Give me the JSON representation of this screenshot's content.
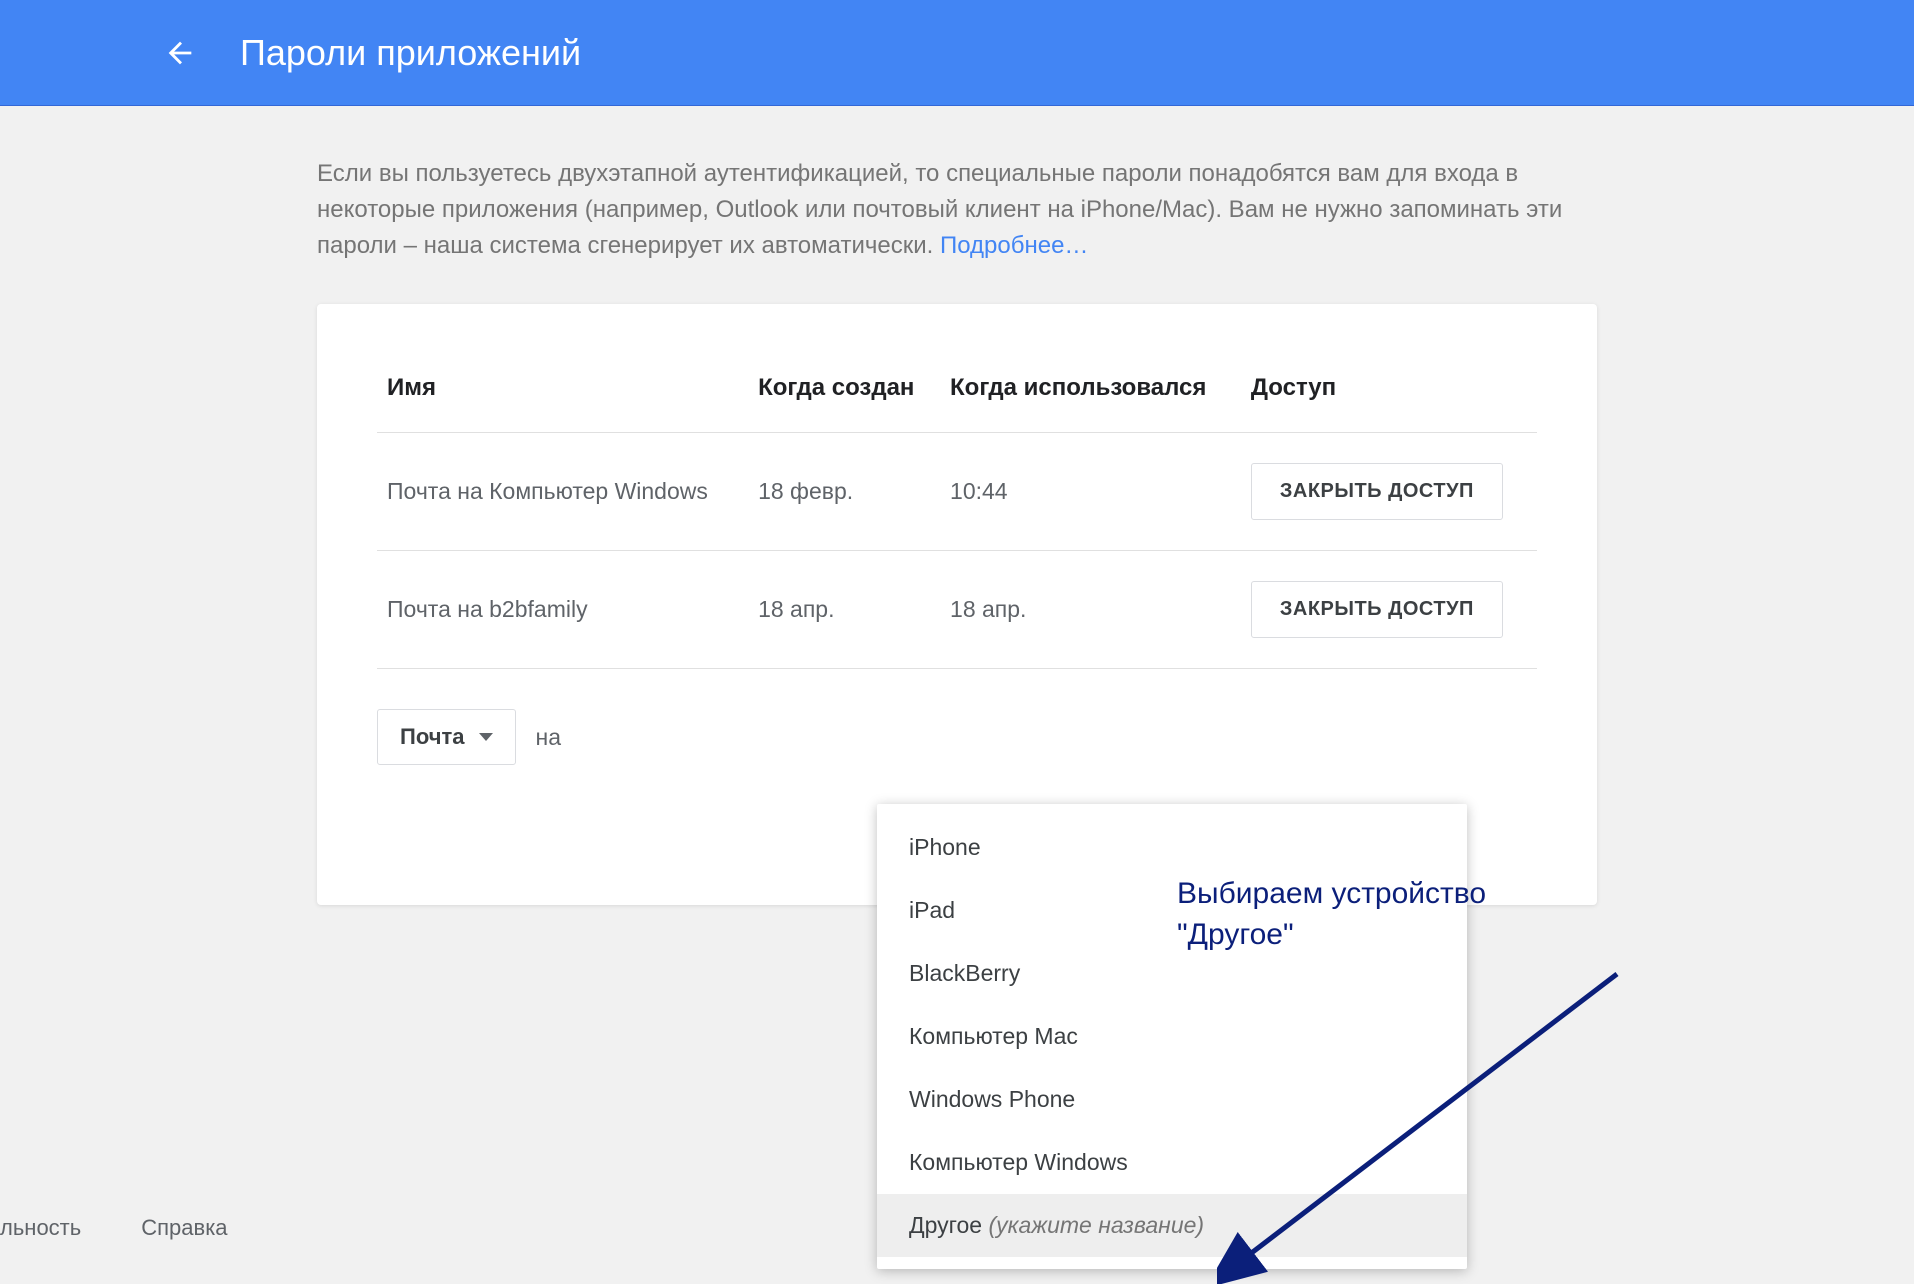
{
  "header": {
    "title": "Пароли приложений"
  },
  "intro": {
    "text_before_link": "Если вы пользуетесь двухэтапной аутентификацией, то специальные пароли понадобятся вам для входа в некоторые приложения (например, Outlook или почтовый клиент на iPhone/Mac). Вам не нужно запоминать эти пароли – наша система сгенерирует их автоматически. ",
    "link": "Подробнее…"
  },
  "table": {
    "headers": {
      "name": "Имя",
      "created": "Когда создан",
      "used": "Когда использовался",
      "access": "Доступ"
    },
    "revoke_label": "ЗАКРЫТЬ ДОСТУП",
    "rows": [
      {
        "name": "Почта на Компьютер Windows",
        "created": "18 февр.",
        "used": "10:44"
      },
      {
        "name": "Почта на b2bfamily",
        "created": "18 апр.",
        "used": "18 апр."
      }
    ]
  },
  "selector": {
    "app_label": "Почта",
    "on": "на"
  },
  "dropdown": {
    "items": [
      {
        "label": "iPhone"
      },
      {
        "label": "iPad"
      },
      {
        "label": "BlackBerry"
      },
      {
        "label": "Компьютер Mac"
      },
      {
        "label": "Windows Phone"
      },
      {
        "label": "Компьютер Windows"
      },
      {
        "label": "Другое ",
        "hint": "(укажите название)",
        "highlight": true
      }
    ]
  },
  "annotation": {
    "line1": "Выбираем устройство",
    "line2": "\"Другое\""
  },
  "footer": {
    "item1": "льность",
    "item2": "Справка"
  },
  "colors": {
    "accent": "#4285f4",
    "annotation": "#0b1f7a"
  }
}
